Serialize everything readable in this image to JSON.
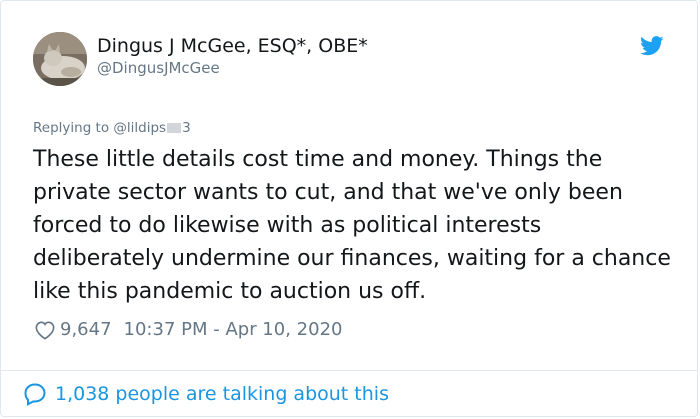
{
  "author": {
    "display_name": "Dingus J McGee, ESQ*, OBE*",
    "handle": "@DingusJMcGee"
  },
  "reply": {
    "prefix": "Replying to",
    "handle_start": "@lildips",
    "handle_end": "3"
  },
  "tweet": {
    "text": "These little details cost time and money. Things the private sector wants to cut, and that we've only been forced to do likewise with as political interests deliberately undermine our finances, waiting for a chance like this pandemic to auction us off."
  },
  "meta": {
    "likes": "9,647",
    "timestamp": "10:37 PM - Apr 10, 2020"
  },
  "footer": {
    "label": "1,038 people are talking about this"
  },
  "icons": {
    "brand": "twitter-bird-icon",
    "like": "heart-icon",
    "talk": "speech-bubble-icon"
  },
  "colors": {
    "accent": "#1b95e0",
    "secondary_text": "#657786",
    "primary_text": "#14171a",
    "border": "#e1e8ed"
  }
}
